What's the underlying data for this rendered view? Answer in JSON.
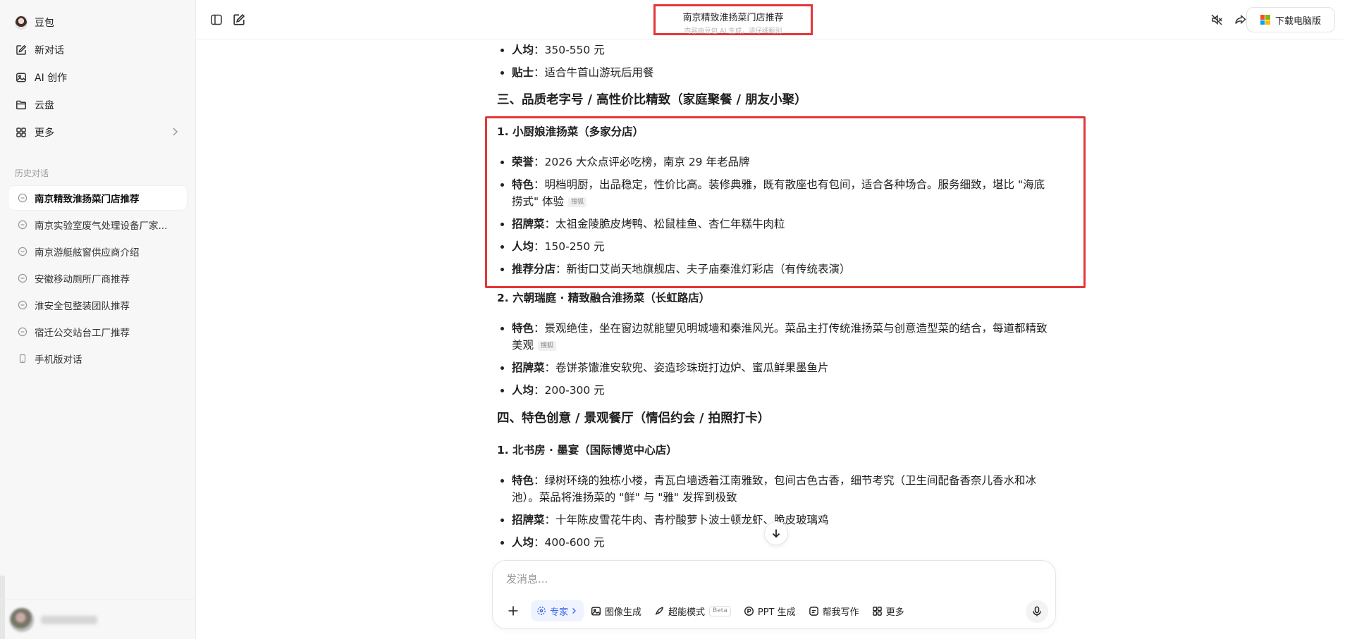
{
  "sidebar": {
    "app_name": "豆包",
    "nav": [
      {
        "label": "新对话",
        "icon": "edit-icon"
      },
      {
        "label": "AI 创作",
        "icon": "image-icon"
      },
      {
        "label": "云盘",
        "icon": "folder-icon"
      },
      {
        "label": "更多",
        "icon": "grid-icon"
      }
    ],
    "history_label": "历史对话",
    "history": [
      "南京精致淮扬菜门店推荐",
      "南京实验室废气处理设备厂家...",
      "南京游艇舷窗供应商介绍",
      "安徽移动厕所厂商推荐",
      "淮安全包整装团队推荐",
      "宿迁公交站台工厂推荐",
      "手机版对话"
    ]
  },
  "header": {
    "title": "南京精致淮扬菜门店推荐",
    "subtitle": "内容由豆包 AI 生成，请仔细甄别",
    "download_label": "下载电脑版"
  },
  "content": {
    "top_items": [
      {
        "k": "人均",
        "v": "：350-550 元"
      },
      {
        "k": "贴士",
        "v": "：适合牛首山游玩后用餐"
      }
    ],
    "section3": "三、品质老字号 / 高性价比精致（家庭聚餐 / 朋友小聚）",
    "r1_title": "1. 小厨娘淮扬菜（多家分店）",
    "r1": [
      {
        "k": "荣誉",
        "v": "：2026 大众点评必吃榜，南京 29 年老品牌"
      },
      {
        "k": "特色",
        "v": "：明档明厨，出品稳定，性价比高。装修典雅，既有散座也有包间，适合各种场合。服务细致，堪比 \"海底捞式\" 体验",
        "tag": "搜狐"
      },
      {
        "k": "招牌菜",
        "v": "：太祖金陵脆皮烤鸭、松鼠桂鱼、杏仁年糕牛肉粒"
      },
      {
        "k": "人均",
        "v": "：150-250 元"
      },
      {
        "k": "推荐分店",
        "v": "：新街口艾尚天地旗舰店、夫子庙秦淮灯彩店（有传统表演）"
      }
    ],
    "r2_title": "2. 六朝瑞庭 · 精致融合淮扬菜（长虹路店）",
    "r2": [
      {
        "k": "特色",
        "v": "：景观绝佳，坐在窗边就能望见明城墙和秦淮风光。菜品主打传统淮扬菜与创意造型菜的结合，每道都精致美观",
        "tag": "搜狐"
      },
      {
        "k": "招牌菜",
        "v": "：卷饼茶馓淮安软兜、姿造珍珠斑打边炉、蜜瓜鲜果墨鱼片"
      },
      {
        "k": "人均",
        "v": "：200-300 元"
      }
    ],
    "section4": "四、特色创意 / 景观餐厅（情侣约会 / 拍照打卡）",
    "r3_title": "1. 北书房 · 墨宴（国际博览中心店）",
    "r3": [
      {
        "k": "特色",
        "v": "：绿树环绕的独栋小楼，青瓦白墙透着江南雅致，包间古色古香，细节考究（卫生间配备香奈儿香水和冰池）。菜品将淮扬菜的 \"鲜\" 与 \"雅\" 发挥到极致"
      },
      {
        "k": "招牌菜",
        "v": "：十年陈皮雪花牛肉、青柠酸萝卜波士顿龙虾、脆皮玻璃鸡"
      },
      {
        "k": "人均",
        "v": "：400-600 元"
      }
    ]
  },
  "composer": {
    "placeholder": "发消息...",
    "tools": {
      "expert": "专家",
      "image": "图像生成",
      "super": "超能模式",
      "beta": "Beta",
      "ppt": "PPT 生成",
      "write": "帮我写作",
      "more": "更多"
    }
  },
  "colors": {
    "highlight_border": "#e3373a",
    "expert_accent": "#3a66e8",
    "sidebar_bg": "#f7f7f8"
  }
}
